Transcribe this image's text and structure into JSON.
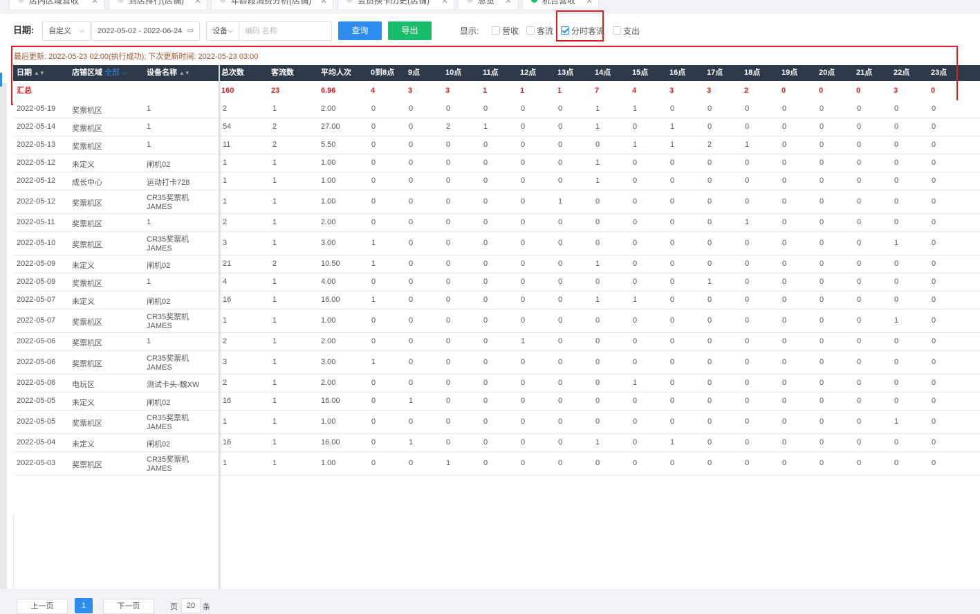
{
  "tabs": [
    {
      "label": "店内区域营收",
      "active": false
    },
    {
      "label": "到店排行(店铺)",
      "active": false
    },
    {
      "label": "年龄段消费分析(店铺)",
      "active": false
    },
    {
      "label": "会员换卡历史(店铺)",
      "active": false
    },
    {
      "label": "总览",
      "active": false
    },
    {
      "label": "机台营收",
      "active": true
    }
  ],
  "filters": {
    "date_label": "日期:",
    "date_mode": "自定义",
    "date_range": "2022-05-02 - 2022-06-24",
    "device_select": "设备",
    "device_placeholder": "编码 名称",
    "query_button": "查询",
    "export_button": "导出",
    "display_label": "显示:",
    "checkboxes": [
      {
        "label": "营收",
        "checked": false
      },
      {
        "label": "客流",
        "checked": false
      },
      {
        "label": "分时客流",
        "checked": true
      },
      {
        "label": "支出",
        "checked": false
      }
    ]
  },
  "info": {
    "last_update_label": "最后更新:",
    "last_update_value": "2022-05-23 02:00(执行成功);",
    "next_update_label": "下次更新时间:",
    "next_update_value": "2022-05-23 03:00"
  },
  "table": {
    "headers": {
      "date": "日期",
      "area": "店铺区域",
      "area_all": "全部",
      "device": "设备名称",
      "total": "总次数",
      "visitors": "客流数",
      "avg": "平均人次",
      "hours": [
        "0到8点",
        "9点",
        "10点",
        "11点",
        "12点",
        "13点",
        "14点",
        "15点",
        "16点",
        "17点",
        "18点",
        "19点",
        "20点",
        "21点",
        "22点",
        "23点"
      ]
    },
    "summary": {
      "label": "汇总",
      "total": "160",
      "visitors": "23",
      "avg": "6.96",
      "hours": [
        "4",
        "3",
        "3",
        "1",
        "1",
        "1",
        "7",
        "4",
        "3",
        "3",
        "2",
        "0",
        "0",
        "0",
        "3",
        "0"
      ]
    },
    "rows": [
      {
        "date": "2022-05-19",
        "area": "奖票机区",
        "device": [
          "1"
        ],
        "total": "2",
        "visitors": "1",
        "avg": "2.00",
        "hours": [
          "0",
          "0",
          "0",
          "0",
          "0",
          "0",
          "1",
          "1",
          "0",
          "0",
          "0",
          "0",
          "0",
          "0",
          "0",
          "0"
        ]
      },
      {
        "date": "2022-05-14",
        "area": "奖票机区",
        "device": [
          "1"
        ],
        "total": "54",
        "visitors": "2",
        "avg": "27.00",
        "hours": [
          "0",
          "0",
          "2",
          "1",
          "0",
          "0",
          "1",
          "0",
          "1",
          "0",
          "0",
          "0",
          "0",
          "0",
          "0",
          "0"
        ]
      },
      {
        "date": "2022-05-13",
        "area": "奖票机区",
        "device": [
          "1"
        ],
        "total": "11",
        "visitors": "2",
        "avg": "5.50",
        "hours": [
          "0",
          "0",
          "0",
          "0",
          "0",
          "0",
          "0",
          "1",
          "1",
          "2",
          "1",
          "0",
          "0",
          "0",
          "0",
          "0"
        ]
      },
      {
        "date": "2022-05-12",
        "area": "未定义",
        "device": [
          "闸机02"
        ],
        "total": "1",
        "visitors": "1",
        "avg": "1.00",
        "hours": [
          "0",
          "0",
          "0",
          "0",
          "0",
          "0",
          "1",
          "0",
          "0",
          "0",
          "0",
          "0",
          "0",
          "0",
          "0",
          "0"
        ]
      },
      {
        "date": "2022-05-12",
        "area": "成长中心",
        "device": [
          "运动打卡728"
        ],
        "total": "1",
        "visitors": "1",
        "avg": "1.00",
        "hours": [
          "0",
          "0",
          "0",
          "0",
          "0",
          "0",
          "1",
          "0",
          "0",
          "0",
          "0",
          "0",
          "0",
          "0",
          "0",
          "0"
        ]
      },
      {
        "date": "2022-05-12",
        "area": "奖票机区",
        "device": [
          "CR35奖票机",
          "JAMES"
        ],
        "total": "1",
        "visitors": "1",
        "avg": "1.00",
        "hours": [
          "0",
          "0",
          "0",
          "0",
          "0",
          "1",
          "0",
          "0",
          "0",
          "0",
          "0",
          "0",
          "0",
          "0",
          "0",
          "0"
        ]
      },
      {
        "date": "2022-05-11",
        "area": "奖票机区",
        "device": [
          "1"
        ],
        "total": "2",
        "visitors": "1",
        "avg": "2.00",
        "hours": [
          "0",
          "0",
          "0",
          "0",
          "0",
          "0",
          "0",
          "0",
          "0",
          "0",
          "1",
          "0",
          "0",
          "0",
          "0",
          "0"
        ]
      },
      {
        "date": "2022-05-10",
        "area": "奖票机区",
        "device": [
          "CR35奖票机",
          "JAMES"
        ],
        "total": "3",
        "visitors": "1",
        "avg": "3.00",
        "hours": [
          "1",
          "0",
          "0",
          "0",
          "0",
          "0",
          "0",
          "0",
          "0",
          "0",
          "0",
          "0",
          "0",
          "0",
          "1",
          "0"
        ]
      },
      {
        "date": "2022-05-09",
        "area": "未定义",
        "device": [
          "闸机02"
        ],
        "total": "21",
        "visitors": "2",
        "avg": "10.50",
        "hours": [
          "1",
          "0",
          "0",
          "0",
          "0",
          "0",
          "1",
          "0",
          "0",
          "0",
          "0",
          "0",
          "0",
          "0",
          "0",
          "0"
        ]
      },
      {
        "date": "2022-05-09",
        "area": "奖票机区",
        "device": [
          "1"
        ],
        "total": "4",
        "visitors": "1",
        "avg": "4.00",
        "hours": [
          "0",
          "0",
          "0",
          "0",
          "0",
          "0",
          "0",
          "0",
          "0",
          "1",
          "0",
          "0",
          "0",
          "0",
          "0",
          "0"
        ]
      },
      {
        "date": "2022-05-07",
        "area": "未定义",
        "device": [
          "闸机02"
        ],
        "total": "16",
        "visitors": "1",
        "avg": "16.00",
        "hours": [
          "1",
          "0",
          "0",
          "0",
          "0",
          "0",
          "1",
          "1",
          "0",
          "0",
          "0",
          "0",
          "0",
          "0",
          "0",
          "0"
        ]
      },
      {
        "date": "2022-05-07",
        "area": "奖票机区",
        "device": [
          "CR35奖票机",
          "JAMES"
        ],
        "total": "1",
        "visitors": "1",
        "avg": "1.00",
        "hours": [
          "0",
          "0",
          "0",
          "0",
          "0",
          "0",
          "0",
          "0",
          "0",
          "0",
          "0",
          "0",
          "0",
          "0",
          "1",
          "0"
        ]
      },
      {
        "date": "2022-05-06",
        "area": "奖票机区",
        "device": [
          "1"
        ],
        "total": "2",
        "visitors": "1",
        "avg": "2.00",
        "hours": [
          "0",
          "0",
          "0",
          "0",
          "1",
          "0",
          "0",
          "0",
          "0",
          "0",
          "0",
          "0",
          "0",
          "0",
          "0",
          "0"
        ]
      },
      {
        "date": "2022-05-06",
        "area": "奖票机区",
        "device": [
          "CR35奖票机",
          "JAMES"
        ],
        "total": "3",
        "visitors": "1",
        "avg": "3.00",
        "hours": [
          "1",
          "0",
          "0",
          "0",
          "0",
          "0",
          "0",
          "0",
          "0",
          "0",
          "0",
          "0",
          "0",
          "0",
          "0",
          "0"
        ]
      },
      {
        "date": "2022-05-06",
        "area": "电玩区",
        "device": [
          "测试卡头-魏XW"
        ],
        "total": "2",
        "visitors": "1",
        "avg": "2.00",
        "hours": [
          "0",
          "0",
          "0",
          "0",
          "0",
          "0",
          "0",
          "1",
          "0",
          "0",
          "0",
          "0",
          "0",
          "0",
          "0",
          "0"
        ]
      },
      {
        "date": "2022-05-05",
        "area": "未定义",
        "device": [
          "闸机02"
        ],
        "total": "16",
        "visitors": "1",
        "avg": "16.00",
        "hours": [
          "0",
          "1",
          "0",
          "0",
          "0",
          "0",
          "0",
          "0",
          "0",
          "0",
          "0",
          "0",
          "0",
          "0",
          "0",
          "0"
        ]
      },
      {
        "date": "2022-05-05",
        "area": "奖票机区",
        "device": [
          "CR35奖票机",
          "JAMES"
        ],
        "total": "1",
        "visitors": "1",
        "avg": "1.00",
        "hours": [
          "0",
          "0",
          "0",
          "0",
          "0",
          "0",
          "0",
          "0",
          "0",
          "0",
          "0",
          "0",
          "0",
          "0",
          "1",
          "0"
        ]
      },
      {
        "date": "2022-05-04",
        "area": "未定义",
        "device": [
          "闸机02"
        ],
        "total": "16",
        "visitors": "1",
        "avg": "16.00",
        "hours": [
          "0",
          "1",
          "0",
          "0",
          "0",
          "0",
          "1",
          "0",
          "1",
          "0",
          "0",
          "0",
          "0",
          "0",
          "0",
          "0"
        ]
      },
      {
        "date": "2022-05-03",
        "area": "奖票机区",
        "device": [
          "CR35奖票机",
          "JAMES"
        ],
        "total": "1",
        "visitors": "1",
        "avg": "1.00",
        "hours": [
          "0",
          "0",
          "1",
          "0",
          "0",
          "0",
          "0",
          "0",
          "0",
          "0",
          "0",
          "0",
          "0",
          "0",
          "0",
          "0"
        ]
      }
    ]
  },
  "pagination": {
    "prev": "上一页",
    "current": "1",
    "next": "下一页",
    "page_prefix": "页",
    "page_size": "20",
    "page_suffix": "条"
  }
}
